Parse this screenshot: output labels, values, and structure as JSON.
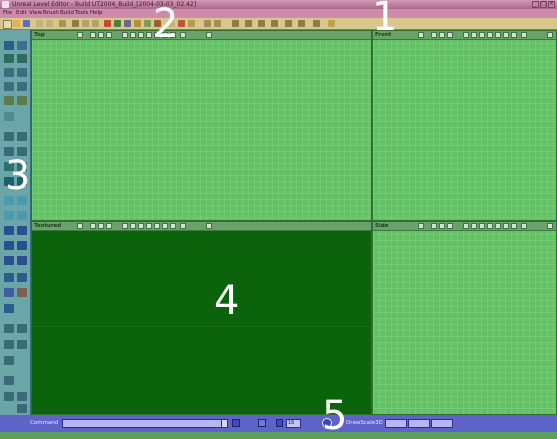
{
  "window": {
    "title": "Unreal Level Editor - Build UT2004_Build_[2004-03-03_02.42]"
  },
  "menu": [
    "File",
    "Edit",
    "View",
    "Brush",
    "Build",
    "Tools",
    "Help"
  ],
  "viewports": {
    "top": {
      "label": "Top"
    },
    "front": {
      "label": "Front"
    },
    "textured": {
      "label": "Textured"
    },
    "side": {
      "label": "Side"
    }
  },
  "status": {
    "command_label": "Command",
    "command_value": "",
    "drawscale_label": "DrawScale3D",
    "grid_value": "16"
  },
  "overlay_numbers": [
    "1",
    "2",
    "3",
    "4",
    "5"
  ],
  "colors": {
    "title_bar": "#c887a9",
    "toolbar": "#d8c78c",
    "left_toolbar": "#6aa6a8",
    "viewport": "#64c064",
    "textured_viewport": "#0b630b",
    "status_bar": "#5d63c8"
  }
}
